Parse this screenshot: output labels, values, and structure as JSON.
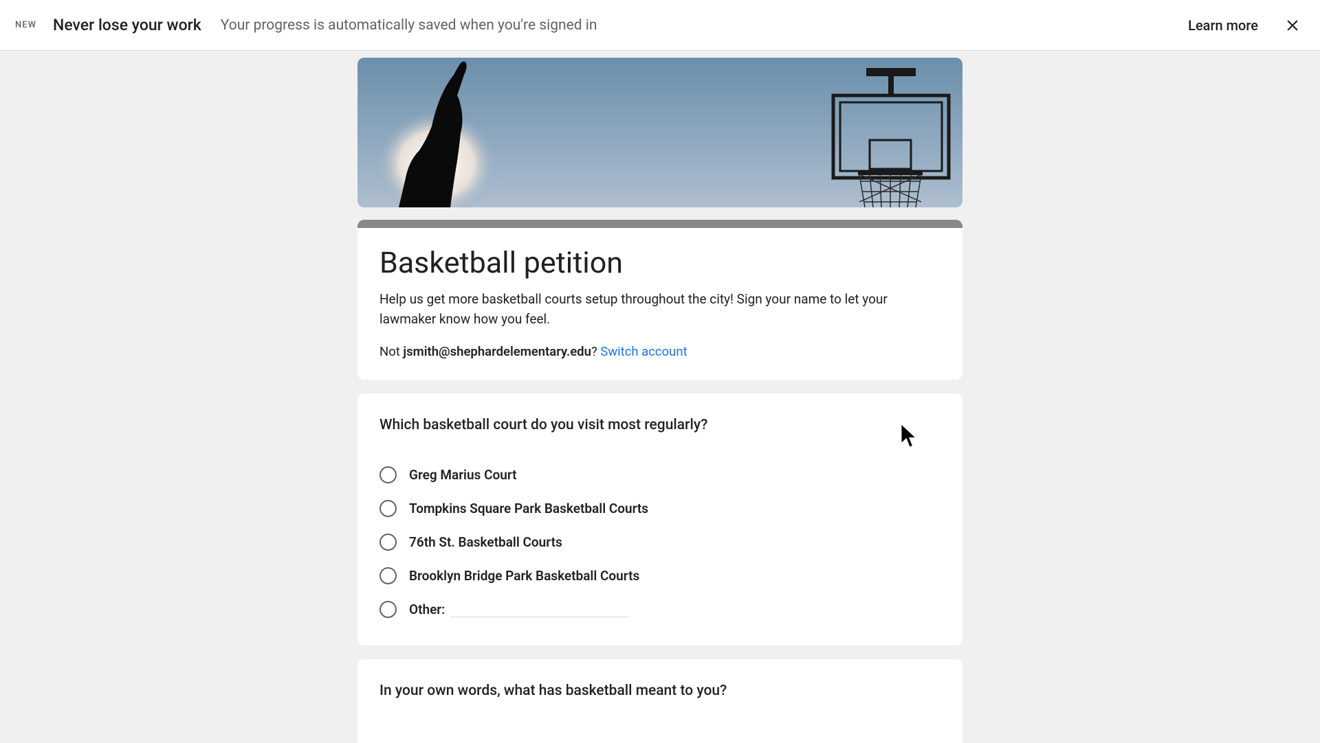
{
  "banner": {
    "badge": "NEW",
    "title": "Never lose your work",
    "subtitle": "Your progress is automatically saved when you're signed in",
    "learn_more": "Learn more"
  },
  "form": {
    "title": "Basketball petition",
    "description": "Help us get more basketball courts setup throughout the city! Sign your name to let your lawmaker know how you feel.",
    "account": {
      "not_prefix": "Not ",
      "email": "jsmith@shephardelementary.edu",
      "question_mark": "? ",
      "switch": "Switch account"
    }
  },
  "q1": {
    "title": "Which basketball court do you visit most regularly?",
    "options": [
      "Greg Marius Court",
      "Tompkins Square Park Basketball Courts",
      "76th St. Basketball Courts",
      "Brooklyn Bridge Park Basketball Courts"
    ],
    "other_label": "Other:"
  },
  "q2": {
    "title": "In your own words, what has basketball meant to you?"
  }
}
